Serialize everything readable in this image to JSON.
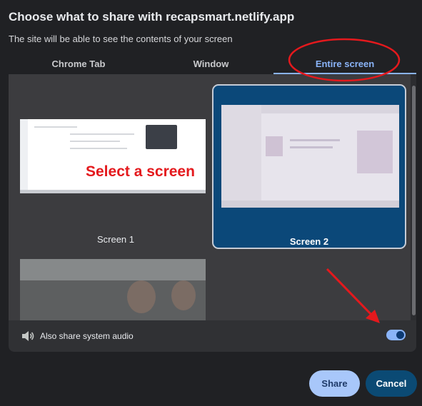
{
  "dialog": {
    "title": "Choose what to share with recapsmart.netlify.app",
    "subtitle": "The site will be able to see the contents of your screen"
  },
  "tabs": [
    {
      "label": "Chrome Tab",
      "selected": false
    },
    {
      "label": "Window",
      "selected": false
    },
    {
      "label": "Entire screen",
      "selected": true
    }
  ],
  "screens": [
    {
      "label": "Screen 1",
      "selected": false,
      "annotation": "Select a screen"
    },
    {
      "label": "Screen 2",
      "selected": true
    },
    {
      "label": "",
      "selected": false
    }
  ],
  "audio": {
    "label": "Also share system audio",
    "enabled": true,
    "icon": "speaker-icon"
  },
  "buttons": {
    "share": "Share",
    "cancel": "Cancel"
  },
  "colors": {
    "accent": "#8ab4f8",
    "selected_tile": "#0b4879",
    "annotation_red": "#e4191d",
    "share_button": "#a8c7fa",
    "cancel_button": "#0b4a74"
  }
}
